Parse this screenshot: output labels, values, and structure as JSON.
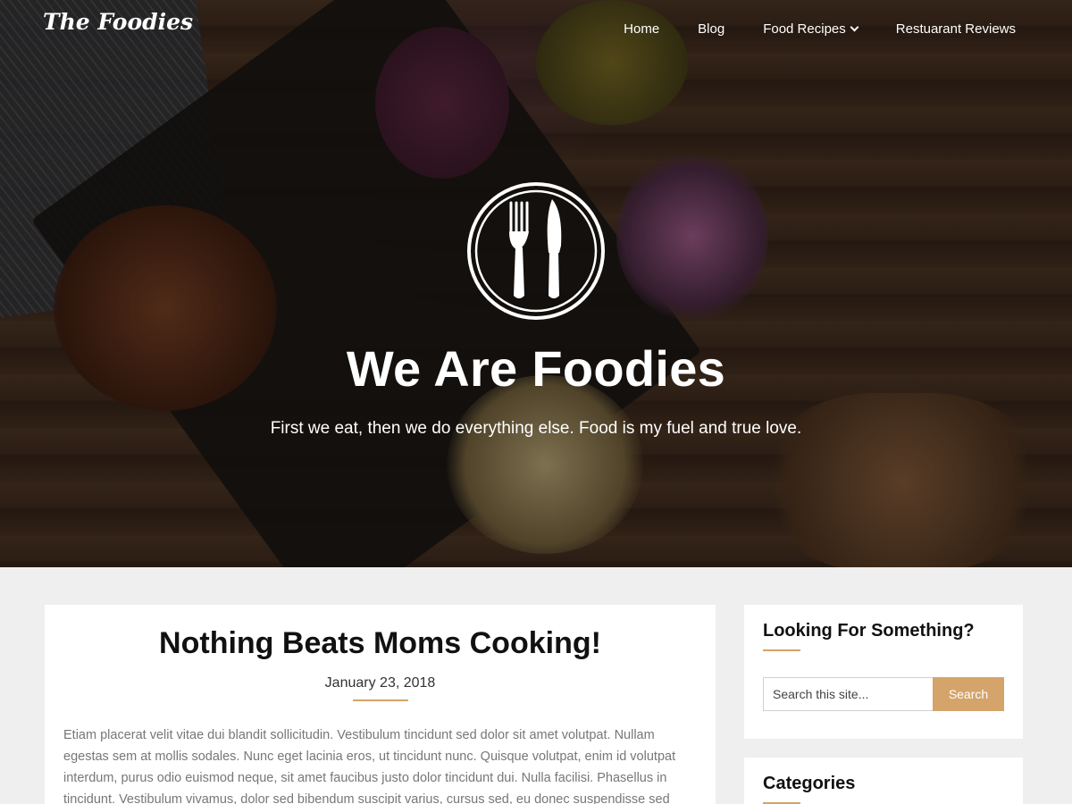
{
  "site": {
    "logo_text": "The Foodies"
  },
  "nav": {
    "items": [
      {
        "label": "Home"
      },
      {
        "label": "Blog"
      },
      {
        "label": "Food Recipes"
      },
      {
        "label": "Restuarant Reviews"
      }
    ]
  },
  "hero": {
    "title": "We Are Foodies",
    "subtitle": "First we eat, then we do everything else. Food is my fuel and true love."
  },
  "post": {
    "title": "Nothing Beats Moms Cooking!",
    "date": "January 23, 2018",
    "excerpt": "Etiam placerat velit vitae dui blandit sollicitudin. Vestibulum tincidunt sed dolor sit amet volutpat. Nullam egestas sem at mollis sodales. Nunc eget lacinia eros, ut tincidunt nunc. Quisque volutpat, enim id volutpat interdum, purus odio euismod neque, sit amet faucibus justo dolor tincidunt dui. Nulla facilisi. Phasellus in tincidunt. Vestibulum vivamus, dolor sed bibendum suscipit varius, cursus sed, eu donec suspendisse sed"
  },
  "sidebar": {
    "search_widget": {
      "title": "Looking For Something?",
      "placeholder": "Search this site...",
      "button_label": "Search"
    },
    "categories_widget": {
      "title": "Categories"
    }
  },
  "colors": {
    "accent": "#d4a46a",
    "page_bg": "#efefef",
    "card_bg": "#ffffff"
  },
  "icons": {
    "emblem": "fork-knife-icon",
    "dropdown": "chevron-down-icon"
  }
}
